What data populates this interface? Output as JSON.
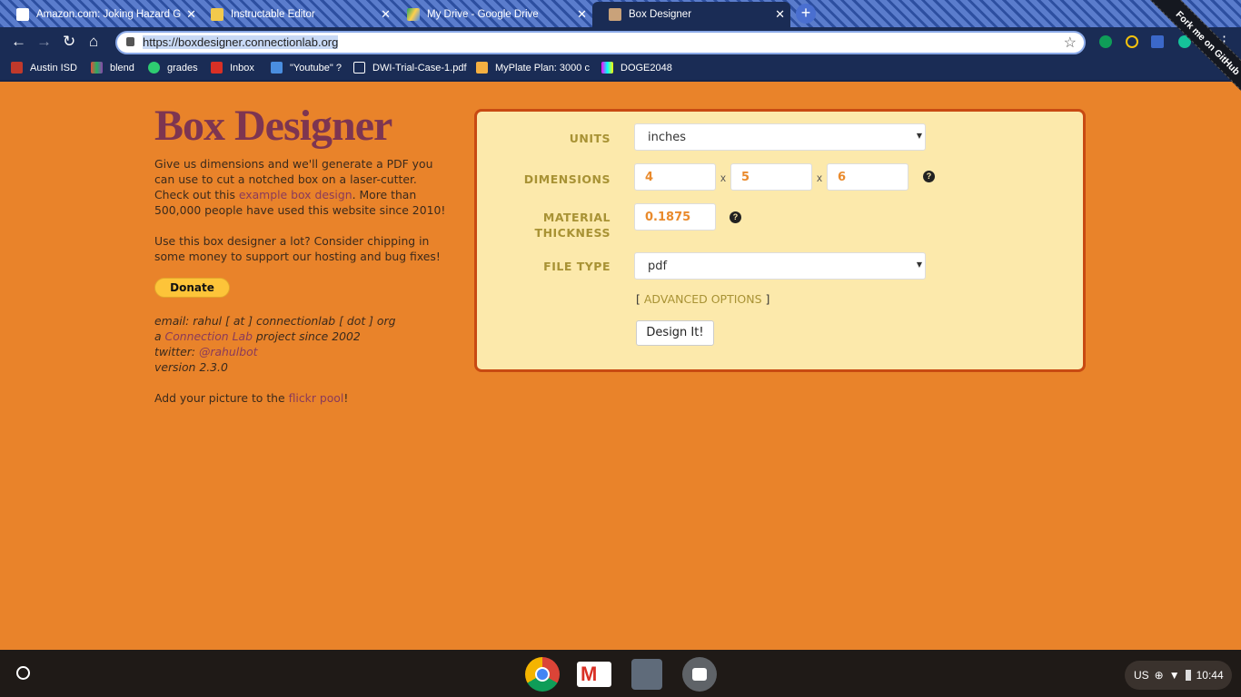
{
  "browser": {
    "tabs": [
      {
        "title": "Amazon.com: Joking Hazard G",
        "active": false
      },
      {
        "title": "Instructable Editor",
        "active": false
      },
      {
        "title": "My Drive - Google Drive",
        "active": false
      },
      {
        "title": "Box Designer",
        "active": true
      }
    ],
    "url": "https://boxdesigner.connectionlab.org",
    "bookmarks": [
      "Austin ISD",
      "blend",
      "grades",
      "Inbox",
      "\"Youtube\" ?",
      "DWI-Trial-Case-1.pdf",
      "MyPlate Plan: 3000 c",
      "DOGE2048"
    ]
  },
  "page": {
    "title": "Box Designer",
    "intro_1": "Give us dimensions and we'll generate a PDF you can use to cut a notched box on a laser-cutter. Check out this ",
    "intro_link": "example box design",
    "intro_2": ". More than 500,000 people have used this website since 2010!",
    "support": "Use this box designer a lot? Consider chipping in some money to support our hosting and bug fixes!",
    "donate": "Donate",
    "email": "email: rahul [ at ] connectionlab [ dot ] org",
    "project_a": "a ",
    "project_link": "Connection Lab",
    "project_b": " project since 2002",
    "twitter_label": "twitter: ",
    "twitter_link": "@rahulbot",
    "version": "version 2.3.0",
    "flickr_a": "Add your picture to the ",
    "flickr_link": "flickr pool",
    "flickr_b": "!",
    "ribbon": "Fork me on GitHub"
  },
  "form": {
    "units_label": "UNITS",
    "units_value": "inches",
    "dimensions_label": "DIMENSIONS",
    "dim_x": "4",
    "dim_y": "5",
    "dim_z": "6",
    "times": "x",
    "thickness_label_1": "MATERIAL",
    "thickness_label_2": "THICKNESS",
    "thickness_value": "0.1875",
    "filetype_label": "FILE TYPE",
    "filetype_value": "pdf",
    "advanced_open": "[",
    "advanced": "ADVANCED OPTIONS",
    "advanced_close": "]",
    "submit": "Design It!"
  },
  "shelf": {
    "locale": "US",
    "time": "10:44"
  },
  "colors": {
    "background": "#E9832A",
    "panel": "#FCE9AB",
    "panel_border": "#C84A12",
    "title": "#7D3551",
    "label": "#A89234",
    "input_text": "#E98A2C"
  }
}
